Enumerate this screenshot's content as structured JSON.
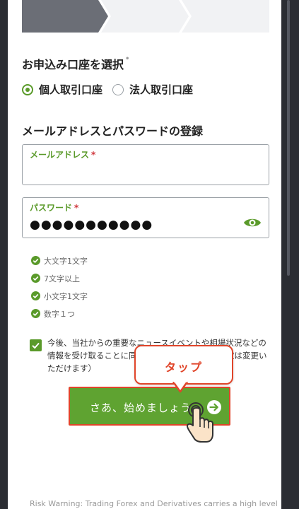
{
  "stepper": {
    "steps": 3,
    "active_step": 1
  },
  "account_section": {
    "title": "お申込み口座を選択",
    "required_mark": "•",
    "options": [
      {
        "label": "個人取引口座",
        "selected": true
      },
      {
        "label": "法人取引口座",
        "selected": false
      }
    ]
  },
  "credentials_section": {
    "title": "メールアドレスとパスワードの登録",
    "email": {
      "label": "メールアドレス",
      "required": "*",
      "value": ""
    },
    "password": {
      "label": "パスワード",
      "required": "*",
      "value": "●●●●●●●●●●●",
      "toggle_icon": "eye-icon"
    }
  },
  "password_rules": [
    {
      "text": "大文字1文字",
      "met": true
    },
    {
      "text": "7文字以上",
      "met": true
    },
    {
      "text": "小文字1文字",
      "met": true
    },
    {
      "text": "数字１つ",
      "met": true
    }
  ],
  "consent": {
    "checked": true,
    "text": "今後、当社からの重要なニュースイベントや相場状況などの情報を受け取ることに同意します（同意は後、設定は変更いただけます）"
  },
  "cta": {
    "label": "さあ、始めましょう",
    "icon": "arrow-right-circle-icon"
  },
  "tooltip": {
    "text": "タップ"
  },
  "footer": {
    "risk_warning": "Risk Warning: Trading Forex and Derivatives carries a high level"
  },
  "colors": {
    "accent": "#5a9a2a",
    "button": "#5fa331",
    "highlight": "#e0452a",
    "stepper": "#6b6e76"
  }
}
